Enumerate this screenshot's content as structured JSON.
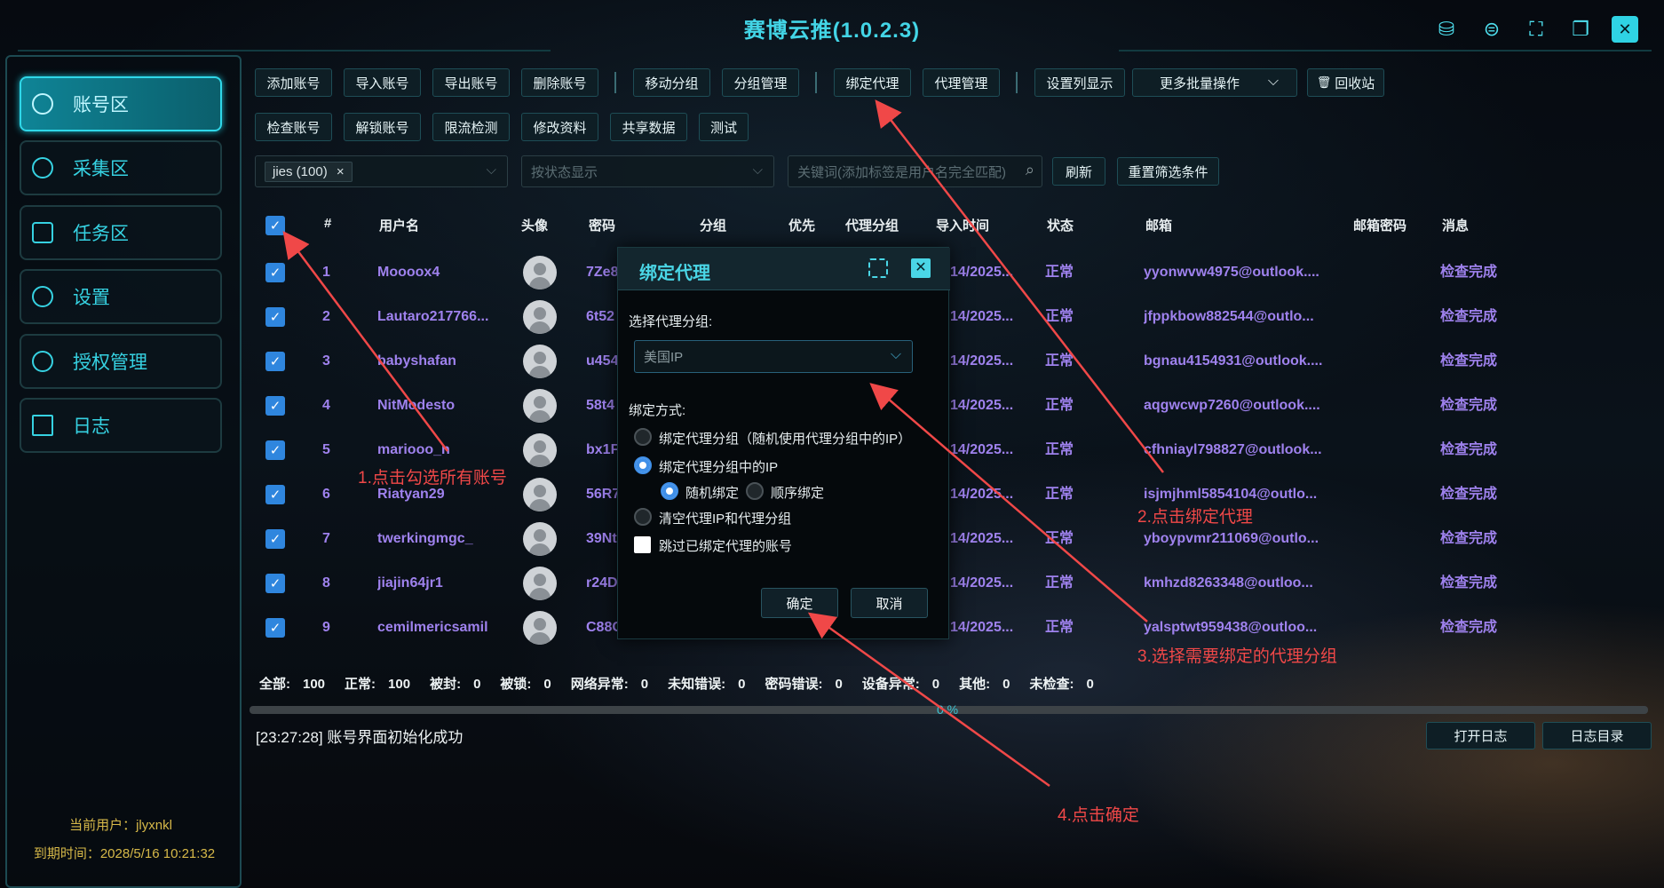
{
  "app": {
    "title": "赛博云推(1.0.2.3)"
  },
  "window_controls": [
    {
      "name": "database-icon",
      "glyph": "⛁"
    },
    {
      "name": "refresh-circle-icon",
      "glyph": "⊜"
    },
    {
      "name": "fullscreen-icon",
      "glyph": "⛶"
    },
    {
      "name": "window-restore-icon",
      "glyph": "❐"
    },
    {
      "name": "close-icon",
      "glyph": "✕"
    }
  ],
  "sidebar": {
    "items": [
      {
        "label": "账号区",
        "icon": "user-icon",
        "active": true
      },
      {
        "label": "采集区",
        "icon": "globe-icon",
        "active": false
      },
      {
        "label": "任务区",
        "icon": "puzzle-icon",
        "active": false
      },
      {
        "label": "设置",
        "icon": "gear-icon",
        "active": false
      },
      {
        "label": "授权管理",
        "icon": "users-icon",
        "active": false
      },
      {
        "label": "日志",
        "icon": "document-icon",
        "active": false
      }
    ],
    "current_user": "当前用户：jlyxnkl",
    "expire": "到期时间：2028/5/16 10:21:32"
  },
  "toolbar": {
    "row1": [
      "添加账号",
      "导入账号",
      "导出账号",
      "删除账号",
      "移动分组",
      "分组管理",
      "绑定代理",
      "代理管理",
      "设置列显示",
      "更多批量操作",
      "回收站"
    ],
    "row2": [
      "检查账号",
      "解锁账号",
      "限流检测",
      "修改资料",
      "共享数据",
      "测试"
    ]
  },
  "filters": {
    "group_tag": "jies (100)",
    "group_tag_close": "×",
    "status_placeholder": "按状态显示",
    "keyword_placeholder": "关键词(添加标签是用户名完全匹配)",
    "refresh": "刷新",
    "reset": "重置筛选条件"
  },
  "table": {
    "headers": [
      "#",
      "用户名",
      "头像",
      "密码",
      "分组",
      "优先",
      "代理分组",
      "导入时间",
      "状态",
      "邮箱",
      "邮箱密码",
      "消息"
    ],
    "rows": [
      {
        "n": "1",
        "user": "Moooox4",
        "pwd": "7Ze8",
        "time": "14/2025...",
        "status": "正常",
        "email": "yyonwvw4975@outlook....",
        "msg": "检查完成"
      },
      {
        "n": "2",
        "user": "Lautaro217766...",
        "pwd": "6t52",
        "time": "14/2025...",
        "status": "正常",
        "email": "jfppkbow882544@outlo...",
        "msg": "检查完成"
      },
      {
        "n": "3",
        "user": "babyshafan",
        "pwd": "u454",
        "time": "14/2025...",
        "status": "正常",
        "email": "bgnau4154931@outlook....",
        "msg": "检查完成"
      },
      {
        "n": "4",
        "user": "NitModesto",
        "pwd": "58t4",
        "time": "14/2025...",
        "status": "正常",
        "email": "aqgwcwp7260@outlook....",
        "msg": "检查完成"
      },
      {
        "n": "5",
        "user": "mariooo_n",
        "pwd": "bx1F",
        "time": "14/2025...",
        "status": "正常",
        "email": "cfhniayl798827@outlook...",
        "msg": "检查完成"
      },
      {
        "n": "6",
        "user": "Riatyan29",
        "pwd": "56R7",
        "time": "14/2025...",
        "status": "正常",
        "email": "isjmjhml5854104@outlo...",
        "msg": "检查完成"
      },
      {
        "n": "7",
        "user": "twerkingmgc_",
        "pwd": "39Nt",
        "time": "14/2025...",
        "status": "正常",
        "email": "yboypvmr211069@outlo...",
        "msg": "检查完成"
      },
      {
        "n": "8",
        "user": "jiajin64jr1",
        "pwd": "r24D",
        "time": "14/2025...",
        "status": "正常",
        "email": "kmhzd8263348@outloo...",
        "msg": "检查完成"
      },
      {
        "n": "9",
        "user": "cemilmericsamil",
        "pwd": "C88C",
        "time": "14/2025...",
        "status": "正常",
        "email": "yalsptwt959438@outloo...",
        "msg": "检查完成"
      }
    ]
  },
  "stats": [
    {
      "label": "全部:",
      "value": "100"
    },
    {
      "label": "正常:",
      "value": "100"
    },
    {
      "label": "被封:",
      "value": "0"
    },
    {
      "label": "被锁:",
      "value": "0"
    },
    {
      "label": "网络异常:",
      "value": "0"
    },
    {
      "label": "未知错误:",
      "value": "0"
    },
    {
      "label": "密码错误:",
      "value": "0"
    },
    {
      "label": "设备异常:",
      "value": "0"
    },
    {
      "label": "其他:",
      "value": "0"
    },
    {
      "label": "未检查:",
      "value": "0"
    }
  ],
  "progress": {
    "text": "0 %",
    "fraction": 0
  },
  "log": {
    "line": "[23:27:28] 账号界面初始化成功",
    "open_log": "打开日志",
    "log_dir": "日志目录"
  },
  "dialog": {
    "title": "绑定代理",
    "group_label": "选择代理分组:",
    "group_value": "美国IP",
    "mode_label": "绑定方式:",
    "opt1": "绑定代理分组（随机使用代理分组中的IP）",
    "opt2": "绑定代理分组中的IP",
    "sub1": "随机绑定",
    "sub2": "顺序绑定",
    "opt3": "清空代理IP和代理分组",
    "skip": "跳过已绑定代理的账号",
    "ok": "确定",
    "cancel": "取消"
  },
  "annotations": {
    "a1": "1.点击勾选所有账号",
    "a2": "2.点击绑定代理",
    "a3": "3.选择需要绑定的代理分组",
    "a4": "4.点击确定"
  },
  "colors": {
    "accent": "#43d5e6",
    "username": "#9f82ee",
    "annotation": "#f04848",
    "checkbox": "#2f86de",
    "expire_text": "#d7b949"
  }
}
